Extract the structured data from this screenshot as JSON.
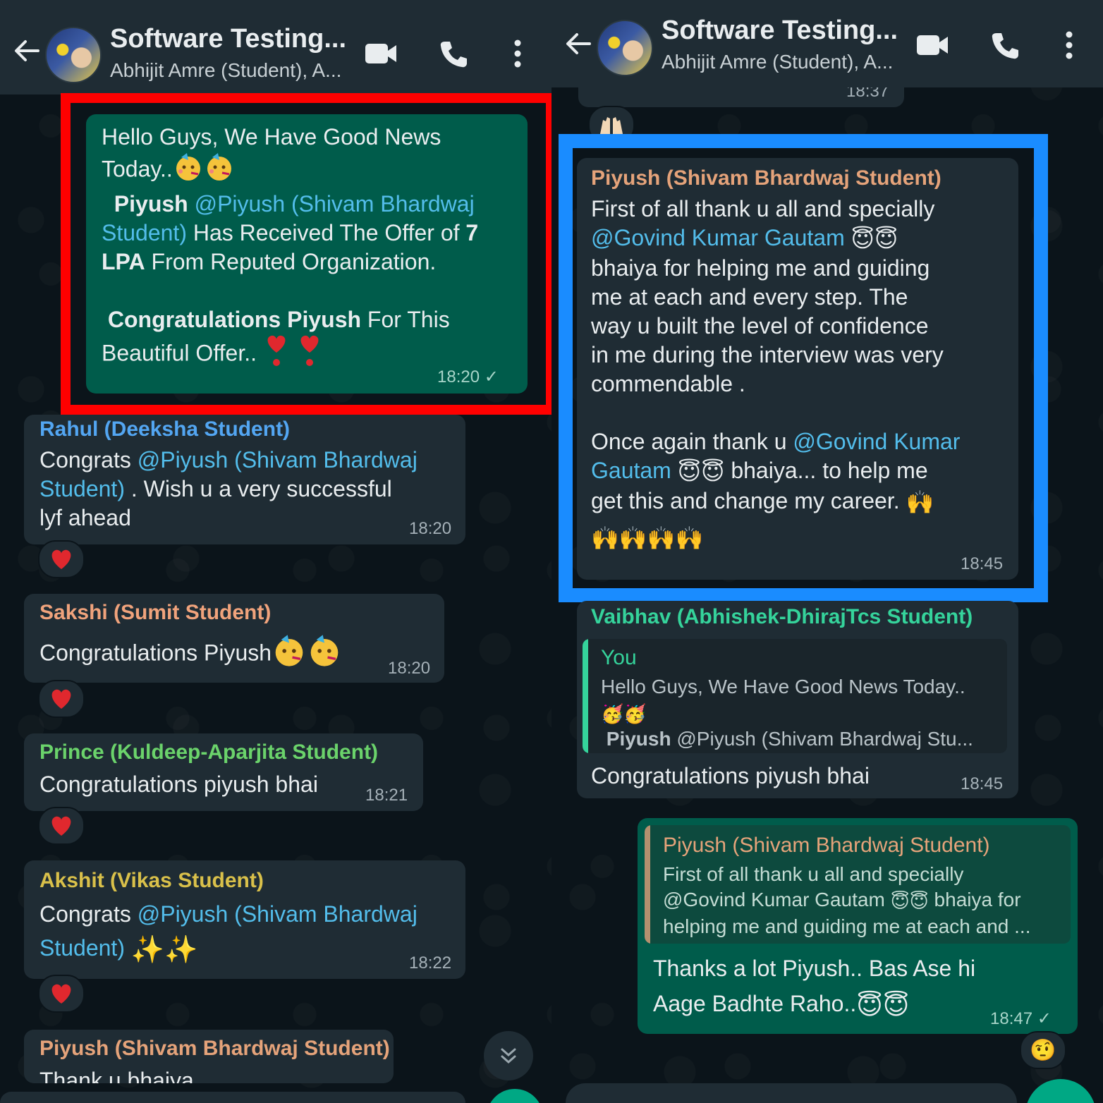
{
  "header": {
    "title": "Software Testing...",
    "subtitle": "Abhijit Amre (Student), A..."
  },
  "left": {
    "msg_offer": {
      "line1": "Hello Guys, We Have Good News",
      "line2": "Today..",
      "piyush_bold": "Piyush",
      "mention1": "@Piyush (Shivam Bhardwaj",
      "mention2": "Student)",
      "offer_text": " Has Received The Offer of ",
      "offer_num": "7",
      "lpa": "LPA",
      "org_text": " From Reputed Organization.",
      "congrats_bold": "Congratulations Piyush",
      "for_this": " For This",
      "beautiful": "Beautiful Offer..",
      "time": "18:20"
    },
    "msg_rahul": {
      "sender": "Rahul (Deeksha Student)",
      "pre": "Congrats ",
      "mention1": "@Piyush (Shivam Bhardwaj",
      "mention2": "Student)",
      "rest": " . Wish u a very successful",
      "line3": "lyf ahead",
      "time": "18:20"
    },
    "msg_sakshi": {
      "sender": "Sakshi (Sumit Student)",
      "text": "Congratulations Piyush",
      "time": "18:20"
    },
    "msg_prince": {
      "sender": "Prince (Kuldeep-Aparjita Student)",
      "text": "Congratulations piyush bhai",
      "time": "18:21"
    },
    "msg_akshit": {
      "sender": "Akshit (Vikas Student)",
      "pre": "Congrats ",
      "mention1": "@Piyush (Shivam Bhardwaj",
      "mention2": "Student)",
      "time": "18:22"
    },
    "msg_piyush": {
      "sender": "Piyush (Shivam Bhardwaj Student)",
      "text": "Thank u bhaiya"
    }
  },
  "right": {
    "top_time": "18:37",
    "msg_piyush_thanks": {
      "sender": "Piyush (Shivam Bhardwaj Student)",
      "l1": "First of all thank u all and specially",
      "mention1": "@Govind Kumar Gautam",
      "l3": "bhaiya for helping me and guiding",
      "l4": "me at each and every step. The",
      "l5": "way u built the level of confidence",
      "l6": "in me during the interview was very",
      "l7": "commendable .",
      "l8_pre": "Once again thank u ",
      "mention2a": "@Govind Kumar",
      "mention2b": "Gautam",
      "l9_rest": " bhaiya... to help me",
      "l10": "get this and change my career.",
      "time": "18:45"
    },
    "msg_vaibhav": {
      "sender": "Vaibhav (Abhishek-DhirajTcs Student)",
      "quote_name": "You",
      "quote_line1": "Hello Guys, We Have Good News Today..",
      "quote_bold": "Piyush",
      "quote_line3": " @Piyush (Shivam Bhardwaj Stu...",
      "text": "Congratulations piyush bhai",
      "time": "18:45"
    },
    "msg_reply": {
      "quote_name": "Piyush (Shivam Bhardwaj Student)",
      "quote_l1": "First of all thank u all and specially",
      "quote_l2_pre": "@Govind Kumar Gautam",
      "quote_l2_post": " bhaiya for",
      "quote_l3": "helping me and guiding me at each and ...",
      "l1": "Thanks a lot Piyush.. Bas Ase hi",
      "l2": "Aage Badhte Raho..",
      "time": "18:47"
    }
  },
  "colors": {
    "header_bg": "#1f2c34",
    "chat_bg": "#0b141a",
    "incoming": "#1f2c34",
    "outgoing": "#005c4b",
    "mention": "#53bdeb",
    "highlight_red": "#ff0000",
    "highlight_blue": "#1a8cff",
    "name_rahul": "#53a6f2",
    "name_sakshi": "#f0a37c",
    "name_prince": "#6bd36b",
    "name_akshit": "#d9c04a",
    "name_piyush": "#e5a37a",
    "name_vaibhav": "#35d39b"
  }
}
